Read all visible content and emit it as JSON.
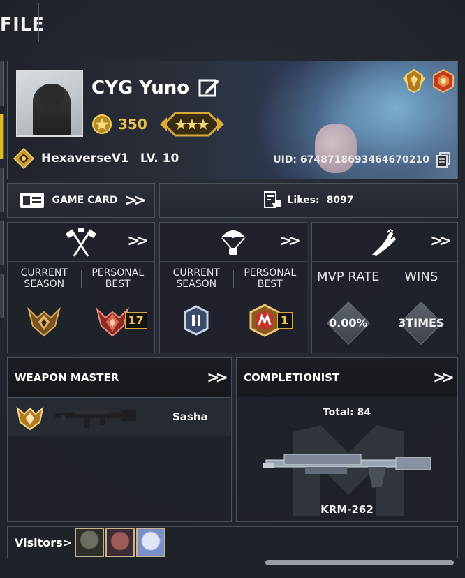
{
  "header": {
    "title": "FILE"
  },
  "profile": {
    "username": "CYG Yuno",
    "cp": "350",
    "clan": "HexaverseV1",
    "level": "LV. 10",
    "uid": "UID: 6748718693464670210"
  },
  "buttons": {
    "game_card": "GAME CARD",
    "likes_label": "Likes:",
    "likes_value": "8097",
    "chevron": ">>"
  },
  "stats": {
    "mp": {
      "col1": "CURRENT\nSEASON",
      "col2": "PERSONAL\nBEST",
      "best_count": "17"
    },
    "br": {
      "col1": "CURRENT\nSEASON",
      "col2": "PERSONAL\nBEST",
      "best_count": "1"
    },
    "other": {
      "col1": "MVP RATE",
      "col2": "WINS",
      "val1": "0.00%",
      "val2": "3TIMES"
    }
  },
  "weapon_master": {
    "title": "WEAPON MASTER",
    "weapon": "Sasha"
  },
  "completionist": {
    "title": "COMPLETIONIST",
    "total": "Total: 84",
    "weapon": "KRM-262"
  },
  "visitors": {
    "label": "Visitors>"
  },
  "icons": [
    "edit-icon",
    "coin-icon",
    "rank-stars-icon",
    "clan-emblem-icon",
    "copy-icon",
    "game-card-icon",
    "likes-icon",
    "crossed-flags-icon",
    "parachute-icon",
    "hand-icon",
    "chevron-double-icon"
  ],
  "colors": {
    "accent": "#e5b91e",
    "gold": "#f0c24a",
    "panel": "#1e2229"
  }
}
